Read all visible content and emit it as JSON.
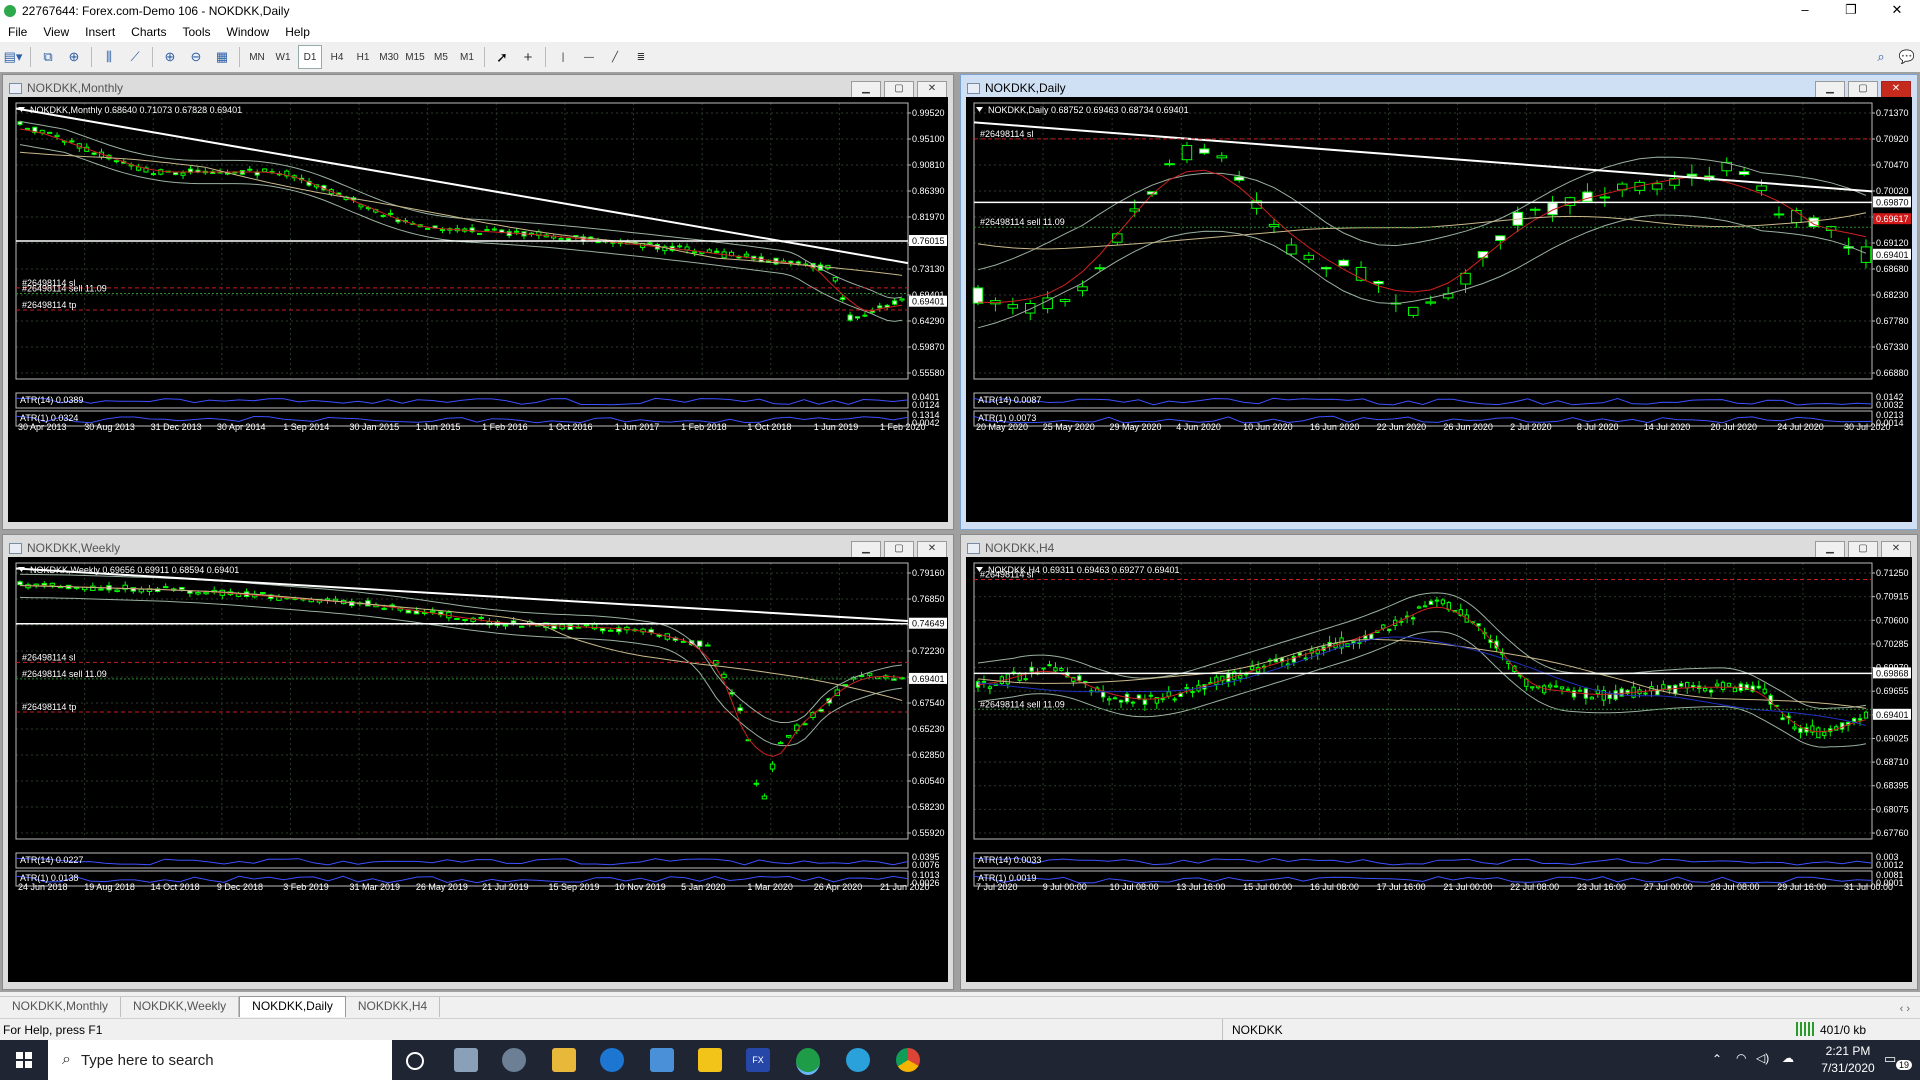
{
  "window": {
    "title": "22767644: Forex.com-Demo 106 - NOKDKK,Daily",
    "controls": [
      "–",
      "❐",
      "✕"
    ]
  },
  "menu": [
    "File",
    "View",
    "Insert",
    "Charts",
    "Tools",
    "Window",
    "Help"
  ],
  "toolbar": {
    "timeframes": [
      "MN",
      "W1",
      "D1",
      "H4",
      "H1",
      "M30",
      "M15",
      "M5",
      "M1"
    ],
    "active_timeframe": "D1"
  },
  "charts": [
    {
      "key": "monthly",
      "window_title": "NOKDKK,Monthly",
      "header": "NOKDKK,Monthly  0.68640 0.71073 0.67828 0.69401",
      "price_labels": [
        "0.99520",
        "0.95100",
        "0.90810",
        "0.86390",
        "0.81970",
        "0.77550",
        "0.73130",
        "0.69401",
        "0.64290",
        "0.59870",
        "0.55580"
      ],
      "hline_label": "0.76015",
      "current_label": "0.69401",
      "order_labels": [
        "#26498114 sl",
        "#26498114 sell 11.09",
        "#26498114 tp"
      ],
      "atr14": "ATR(14) 0.0389",
      "atr1": "ATR(1) 0.0324",
      "atr14_scale": [
        "0.0401",
        "0.0124"
      ],
      "atr1_scale": [
        "0.1314",
        "0.0042"
      ],
      "time_labels": [
        "30 Apr 2013",
        "30 Aug 2013",
        "31 Dec 2013",
        "30 Apr 2014",
        "1 Sep 2014",
        "30 Jan 2015",
        "1 Jun 2015",
        "1 Feb 2016",
        "1 Oct 2016",
        "1 Jun 2017",
        "1 Feb 2018",
        "1 Oct 2018",
        "1 Jun 2019",
        "1 Feb 2020"
      ]
    },
    {
      "key": "daily",
      "window_title": "NOKDKK,Daily",
      "header": "NOKDKK,Daily  0.68752 0.69463 0.68734 0.69401",
      "price_labels": [
        "0.71370",
        "0.70920",
        "0.70470",
        "0.70020",
        "0.69570",
        "0.69120",
        "0.68680",
        "0.68230",
        "0.67780",
        "0.67330",
        "0.66880"
      ],
      "hline_label": "0.69870",
      "current_label": "0.69401",
      "sell_label_price": "0.69617",
      "order_labels": [
        "#26498114 sl",
        "#26498114 sell 11.09"
      ],
      "atr14": "ATR(14) 0.0087",
      "atr1": "ATR(1) 0.0073",
      "atr14_scale": [
        "0.0142",
        "0.0032"
      ],
      "atr1_scale": [
        "0.0213",
        "0.0014"
      ],
      "time_labels": [
        "20 May 2020",
        "25 May 2020",
        "29 May 2020",
        "4 Jun 2020",
        "10 Jun 2020",
        "16 Jun 2020",
        "22 Jun 2020",
        "26 Jun 2020",
        "2 Jul 2020",
        "8 Jul 2020",
        "14 Jul 2020",
        "20 Jul 2020",
        "24 Jul 2020",
        "30 Jul 2020"
      ]
    },
    {
      "key": "weekly",
      "window_title": "NOKDKK,Weekly",
      "header": "NOKDKK,Weekly  0.69656 0.69911 0.68594 0.69401",
      "price_labels": [
        "0.79160",
        "0.76850",
        "0.74649",
        "0.72230",
        "0.69850",
        "0.67540",
        "0.65230",
        "0.62850",
        "0.60540",
        "0.58230",
        "0.55920"
      ],
      "hline_label": "0.74649",
      "current_label": "0.69401",
      "order_labels": [
        "#26498114 sl",
        "#26498114 sell 11.09",
        "#26498114 tp"
      ],
      "atr14": "ATR(14) 0.0227",
      "atr1": "ATR(1) 0.0138",
      "atr14_scale": [
        "0.0395",
        "0.0076"
      ],
      "atr1_scale": [
        "0.1013",
        "0.0026"
      ],
      "time_labels": [
        "24 Jun 2018",
        "19 Aug 2018",
        "14 Oct 2018",
        "9 Dec 2018",
        "3 Feb 2019",
        "31 Mar 2019",
        "26 May 2019",
        "21 Jul 2019",
        "15 Sep 2019",
        "10 Nov 2019",
        "5 Jan 2020",
        "1 Mar 2020",
        "26 Apr 2020",
        "21 Jun 2020"
      ]
    },
    {
      "key": "h4",
      "window_title": "NOKDKK,H4",
      "header": "NOKDKK,H4  0.69311 0.69463 0.69277 0.69401",
      "price_labels": [
        "0.71250",
        "0.70915",
        "0.70600",
        "0.70285",
        "0.69970",
        "0.69655",
        "0.69340",
        "0.69025",
        "0.68710",
        "0.68395",
        "0.68075",
        "0.67760"
      ],
      "hline_label": "0.69868",
      "current_label": "0.69401",
      "order_labels": [
        "#26498114 sl",
        "#26498114 sell 11.09"
      ],
      "atr14": "ATR(14) 0.0033",
      "atr1": "ATR(1) 0.0019",
      "atr14_scale": [
        "0.003",
        "0.0012"
      ],
      "atr1_scale": [
        "0.0081",
        "0.0001"
      ],
      "time_labels": [
        "7 Jul 2020",
        "9 Jul 00:00",
        "10 Jul 08:00",
        "13 Jul 16:00",
        "15 Jul 00:00",
        "16 Jul 08:00",
        "17 Jul 16:00",
        "21 Jul 00:00",
        "22 Jul 08:00",
        "23 Jul 16:00",
        "27 Jul 00:00",
        "28 Jul 08:00",
        "29 Jul 16:00",
        "31 Jul 00:00"
      ]
    }
  ],
  "tabs": [
    "NOKDKK,Monthly",
    "NOKDKK,Weekly",
    "NOKDKK,Daily",
    "NOKDKK,H4"
  ],
  "active_tab": "NOKDKK,Daily",
  "status": {
    "help": "For Help, press F1",
    "symbol": "NOKDKK",
    "traffic": "401/0 kb"
  },
  "taskbar": {
    "search_placeholder": "Type here to search",
    "time": "2:21 PM",
    "date": "7/31/2020",
    "notifications": "19"
  },
  "colors": {
    "chart_bg": "#000000",
    "candle_bull": "#00ff00",
    "candle_bear": "#ffffff",
    "grid": "#2a3a2a",
    "order_line": "#c81e1e",
    "atr_line": "#3c50ff"
  }
}
